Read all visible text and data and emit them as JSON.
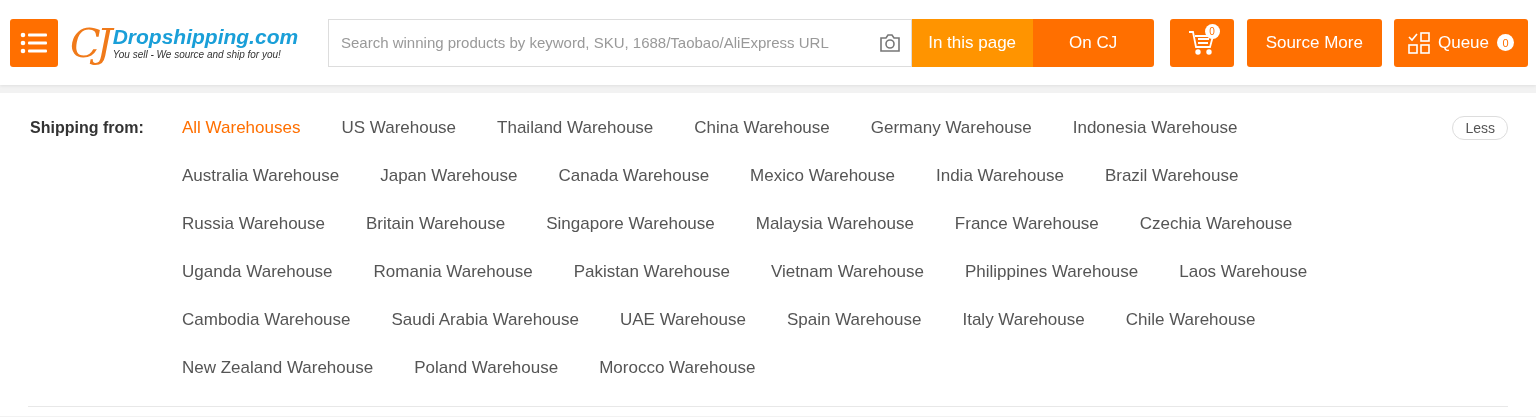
{
  "header": {
    "logo": {
      "mark": "CJ",
      "name": "Dropshipping.com",
      "tagline": "You sell - We source and ship for you!"
    },
    "search": {
      "placeholder": "Search winning products by keyword, SKU, 1688/Taobao/AliExpress URL"
    },
    "scopes": [
      {
        "label": "In this page",
        "selected": true
      },
      {
        "label": "On CJ",
        "selected": false
      }
    ],
    "cart": {
      "count": "0"
    },
    "source_more": "Source More",
    "queue": {
      "label": "Queue",
      "count": "0"
    }
  },
  "filter": {
    "label": "Shipping from:",
    "toggle": "Less",
    "rows": [
      {
        "options": [
          {
            "label": "All Warehouses",
            "selected": true
          },
          {
            "label": "US Warehouse",
            "selected": false
          },
          {
            "label": "Thailand Warehouse",
            "selected": false
          },
          {
            "label": "China Warehouse",
            "selected": false
          },
          {
            "label": "Germany Warehouse",
            "selected": false
          },
          {
            "label": "Indonesia Warehouse",
            "selected": false
          }
        ]
      },
      {
        "options": [
          {
            "label": "Australia Warehouse",
            "selected": false
          },
          {
            "label": "Japan Warehouse",
            "selected": false
          },
          {
            "label": "Canada Warehouse",
            "selected": false
          },
          {
            "label": "Mexico Warehouse",
            "selected": false
          },
          {
            "label": "India Warehouse",
            "selected": false
          },
          {
            "label": "Brazil Warehouse",
            "selected": false
          }
        ]
      },
      {
        "options": [
          {
            "label": "Russia Warehouse",
            "selected": false
          },
          {
            "label": "Britain Warehouse",
            "selected": false
          },
          {
            "label": "Singapore Warehouse",
            "selected": false
          },
          {
            "label": "Malaysia Warehouse",
            "selected": false
          },
          {
            "label": "France Warehouse",
            "selected": false
          },
          {
            "label": "Czechia Warehouse",
            "selected": false
          }
        ]
      },
      {
        "options": [
          {
            "label": "Uganda Warehouse",
            "selected": false
          },
          {
            "label": "Romania Warehouse",
            "selected": false
          },
          {
            "label": "Pakistan Warehouse",
            "selected": false
          },
          {
            "label": "Vietnam Warehouse",
            "selected": false
          },
          {
            "label": "Philippines Warehouse",
            "selected": false
          },
          {
            "label": "Laos Warehouse",
            "selected": false
          }
        ]
      },
      {
        "options": [
          {
            "label": "Cambodia Warehouse",
            "selected": false
          },
          {
            "label": "Saudi Arabia Warehouse",
            "selected": false
          },
          {
            "label": "UAE Warehouse",
            "selected": false
          },
          {
            "label": "Spain Warehouse",
            "selected": false
          },
          {
            "label": "Italy Warehouse",
            "selected": false
          },
          {
            "label": "Chile Warehouse",
            "selected": false
          }
        ]
      },
      {
        "options": [
          {
            "label": "New Zealand Warehouse",
            "selected": false
          },
          {
            "label": "Poland Warehouse",
            "selected": false
          },
          {
            "label": "Morocco Warehouse",
            "selected": false
          }
        ]
      }
    ]
  }
}
